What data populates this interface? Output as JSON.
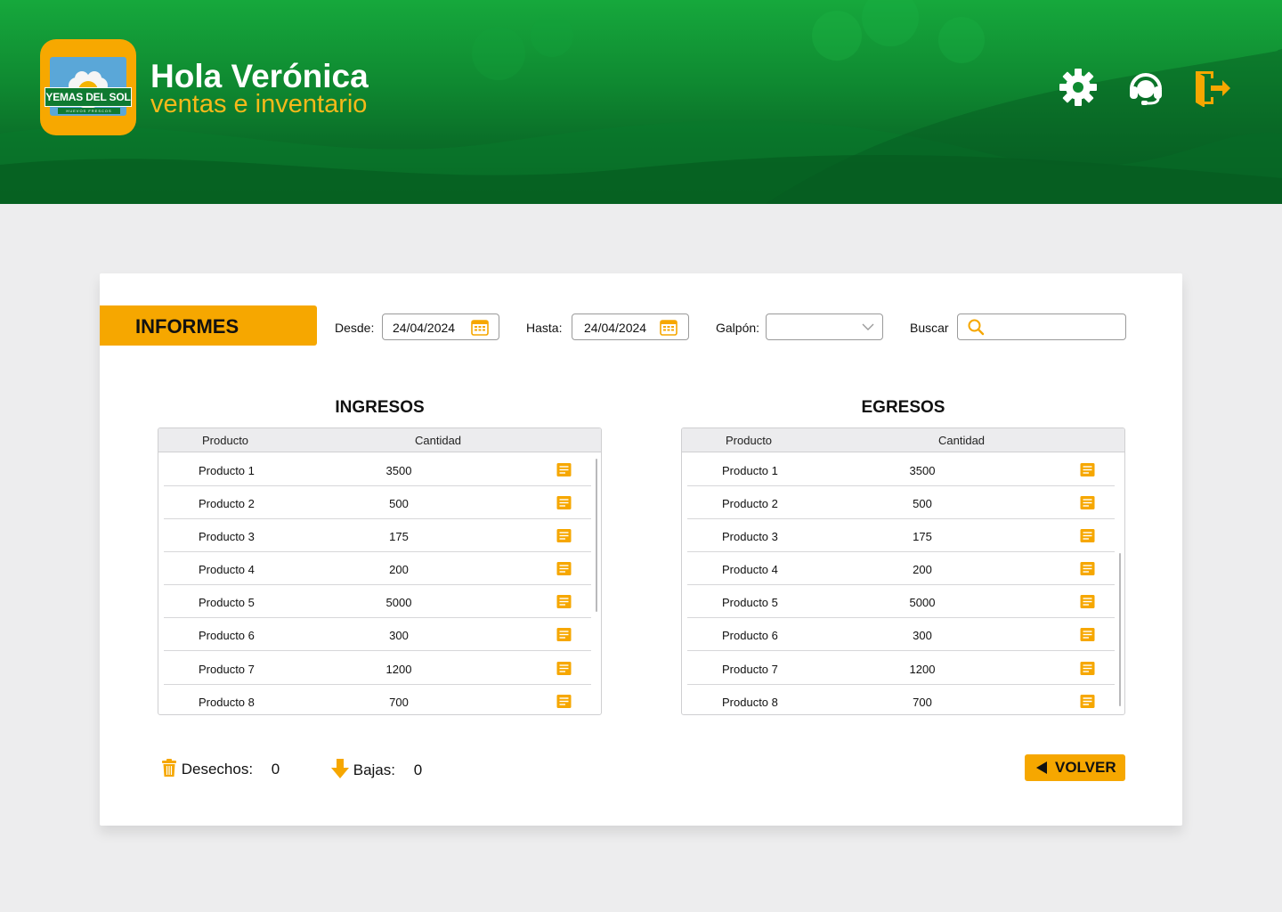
{
  "header": {
    "logo_text": "YEMAS DEL SOL",
    "logo_subtext": "HUEVOS FRESCOS",
    "greeting": "Hola Verónica",
    "subtitle": "ventas e inventario",
    "icons": [
      "gear-icon",
      "support-headset-icon",
      "logout-door-icon"
    ]
  },
  "filters": {
    "section_tab": "INFORMES",
    "desde_label": "Desde:",
    "desde_value": "24/04/2024",
    "hasta_label": "Hasta:",
    "hasta_value": "24/04/2024",
    "galpon_label": "Galpón:",
    "galpon_value": "",
    "buscar_label": "Buscar",
    "buscar_value": ""
  },
  "ingresos": {
    "title": "INGRESOS",
    "col_producto": "Producto",
    "col_cantidad": "Cantidad",
    "rows": [
      {
        "producto": "Producto 1",
        "cantidad": "3500"
      },
      {
        "producto": "Producto 2",
        "cantidad": "500"
      },
      {
        "producto": "Producto 3",
        "cantidad": "175"
      },
      {
        "producto": "Producto 4",
        "cantidad": "200"
      },
      {
        "producto": "Producto 5",
        "cantidad": "5000"
      },
      {
        "producto": "Producto 6",
        "cantidad": "300"
      },
      {
        "producto": "Producto 7",
        "cantidad": "1200"
      },
      {
        "producto": "Producto 8",
        "cantidad": "700"
      }
    ]
  },
  "egresos": {
    "title": "EGRESOS",
    "col_producto": "Producto",
    "col_cantidad": "Cantidad",
    "rows": [
      {
        "producto": "Producto 1",
        "cantidad": "3500"
      },
      {
        "producto": "Producto 2",
        "cantidad": "500"
      },
      {
        "producto": "Producto 3",
        "cantidad": "175"
      },
      {
        "producto": "Producto 4",
        "cantidad": "200"
      },
      {
        "producto": "Producto 5",
        "cantidad": "5000"
      },
      {
        "producto": "Producto 6",
        "cantidad": "300"
      },
      {
        "producto": "Producto 7",
        "cantidad": "1200"
      },
      {
        "producto": "Producto 8",
        "cantidad": "700"
      }
    ]
  },
  "footer": {
    "desechos_label": "Desechos:",
    "desechos_value": "0",
    "bajas_label": "Bajas:",
    "bajas_value": "0",
    "volver_label": "VOLVER"
  },
  "colors": {
    "accent": "#f6a700",
    "header_green": "#0f8a31",
    "background": "#ededee"
  }
}
